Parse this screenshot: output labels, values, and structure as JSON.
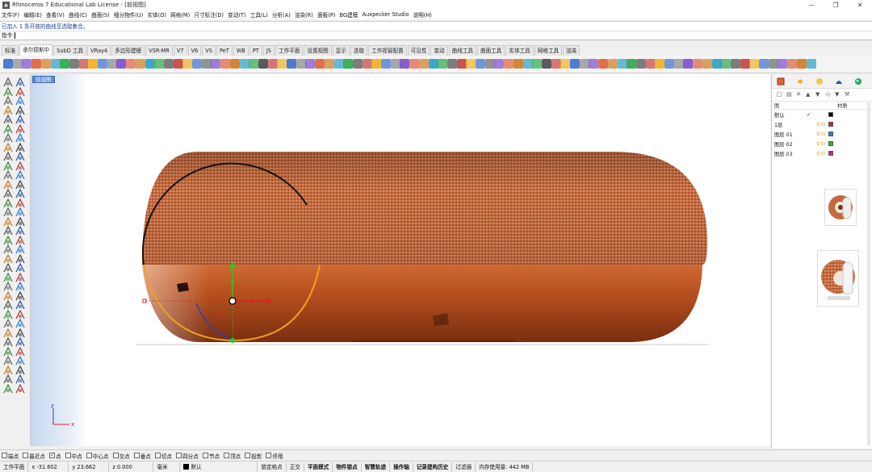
{
  "window": {
    "title": "Rhinoceros 7 Educational Lab License - [前视图]",
    "buttons": [
      "—",
      "❐",
      "✕"
    ]
  },
  "menu": [
    "文件(F)",
    "编辑(E)",
    "查看(V)",
    "曲线(C)",
    "曲面(S)",
    "细分物件(U)",
    "实体(O)",
    "网格(M)",
    "尺寸标注(D)",
    "变动(T)",
    "工具(L)",
    "分析(A)",
    "渲染(R)",
    "面板(P)",
    "BG建模",
    "Auxpecker Studio",
    "说明(H)"
  ],
  "command": {
    "history": "已加入 1 条开放的曲线至选取集合。",
    "prompt": "指令:"
  },
  "tabs": [
    "标准",
    "承尔德斯中",
    "SubD 工具",
    "VRay4",
    "多边形建模",
    "VSR-MR",
    "V7",
    "V6",
    "VS",
    "PeT",
    "WB",
    "PT",
    "JS",
    "工作平面",
    "设置视图",
    "显示",
    "选取",
    "工作视窗配置",
    "可见性",
    "变动",
    "曲线工具",
    "曲面工具",
    "实体工具",
    "网格工具",
    "渲染"
  ],
  "active_tab_index": 1,
  "viewport": {
    "label": "前视图",
    "axis_x": "x",
    "axis_z": "z"
  },
  "colors": {
    "curve_black": "#111111",
    "curve_orange": "#f0a01e",
    "curve_blue": "#2a3ccc",
    "gumball_green": "#22cc22",
    "gumball_red": "#e02020",
    "fabric": "#c86a3e",
    "base": "#b8501e"
  },
  "layers": {
    "header_name": "图",
    "header_material": "材质",
    "rows": [
      {
        "name": "默认",
        "current": "✓",
        "color": "#000000"
      },
      {
        "name": "1层",
        "current": "",
        "color": "#cc2222"
      },
      {
        "name": "图层 01",
        "current": "",
        "color": "#2a7dd6"
      },
      {
        "name": "图层 02",
        "current": "",
        "color": "#22bb22"
      },
      {
        "name": "图层 03",
        "current": "",
        "color": "#cc2288"
      }
    ]
  },
  "osnaps": [
    {
      "label": "端点",
      "checked": false
    },
    {
      "label": "最近点",
      "checked": false
    },
    {
      "label": "点",
      "checked": true
    },
    {
      "label": "中点",
      "checked": false
    },
    {
      "label": "中心点",
      "checked": false
    },
    {
      "label": "交点",
      "checked": false
    },
    {
      "label": "垂点",
      "checked": false
    },
    {
      "label": "切点",
      "checked": false
    },
    {
      "label": "四分点",
      "checked": false
    },
    {
      "label": "节点",
      "checked": false
    },
    {
      "label": "顶点",
      "checked": false
    },
    {
      "label": "投影",
      "checked": false
    },
    {
      "label": "停用",
      "checked": false
    }
  ],
  "status": {
    "cplane": "工作平面",
    "x": "x -31.602",
    "y": "y 23.662",
    "z": "z 0.000",
    "units": "毫米",
    "layer": "默认",
    "items": [
      "锁定格点",
      "正交",
      "平面模式",
      "物件锁点",
      "智慧轨迹",
      "操作轴",
      "记录建构历史",
      "过滤器",
      "内存使用量: 442 MB"
    ]
  }
}
